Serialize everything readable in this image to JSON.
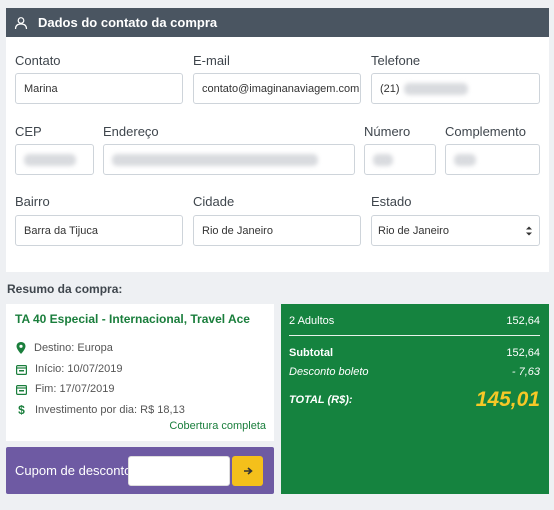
{
  "header": {
    "title": "Dados do contato da compra",
    "icon": "user-icon"
  },
  "form": {
    "contato": {
      "label": "Contato",
      "value": "Marina"
    },
    "email": {
      "label": "E-mail",
      "value": "contato@imaginanaviagem.com"
    },
    "telefone": {
      "label": "Telefone",
      "prefix": "(21)"
    },
    "cep": {
      "label": "CEP"
    },
    "endereco": {
      "label": "Endereço"
    },
    "numero": {
      "label": "Número"
    },
    "complemento": {
      "label": "Complemento"
    },
    "bairro": {
      "label": "Bairro",
      "value": "Barra da Tijuca"
    },
    "cidade": {
      "label": "Cidade",
      "value": "Rio de Janeiro"
    },
    "estado": {
      "label": "Estado",
      "value": "Rio de Janeiro"
    }
  },
  "resumo": {
    "title": "Resumo da compra:",
    "plan": "TA 40 Especial - Internacional, Travel Ace",
    "destino": "Destino: Europa",
    "inicio": "Início: 10/07/2019",
    "fim": "Fim: 17/07/2019",
    "investimento": "Investimento por dia: R$ 18,13",
    "cobertura": "Cobertura completa"
  },
  "coupon": {
    "label": "Cupom de desconto",
    "value": ""
  },
  "totals": {
    "adultos_label": "2 Adultos",
    "adultos_value": "152,64",
    "subtotal_label": "Subtotal",
    "subtotal_value": "152,64",
    "desconto_label": "Desconto boleto",
    "desconto_value": "- 7,63",
    "total_label": "TOTAL (R$):",
    "total_value": "145,01"
  },
  "colors": {
    "header": "#4a5561",
    "green": "#15833f",
    "purple": "#6e5aa3",
    "yellow": "#f4c01b"
  }
}
